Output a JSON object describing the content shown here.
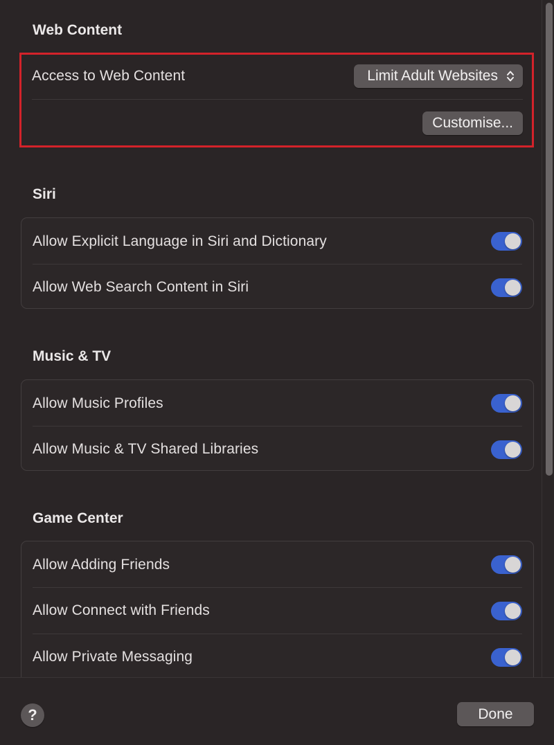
{
  "web_content": {
    "title": "Web Content",
    "access_label": "Access to Web Content",
    "access_value": "Limit Adult Websites",
    "customise_label": "Customise..."
  },
  "siri": {
    "title": "Siri",
    "rows": [
      {
        "label": "Allow Explicit Language in Siri and Dictionary",
        "on": true
      },
      {
        "label": "Allow Web Search Content in Siri",
        "on": true
      }
    ]
  },
  "music_tv": {
    "title": "Music & TV",
    "rows": [
      {
        "label": "Allow Music Profiles",
        "on": true
      },
      {
        "label": "Allow Music & TV Shared Libraries",
        "on": true
      }
    ]
  },
  "game_center": {
    "title": "Game Center",
    "rows": [
      {
        "label": "Allow Adding Friends",
        "on": true
      },
      {
        "label": "Allow Connect with Friends",
        "on": true
      },
      {
        "label": "Allow Private Messaging",
        "on": true
      }
    ]
  },
  "footer": {
    "help_label": "?",
    "done_label": "Done"
  },
  "colors": {
    "background": "#2a2526",
    "toggle_on": "#3a62cf",
    "highlight": "#d3222a"
  }
}
